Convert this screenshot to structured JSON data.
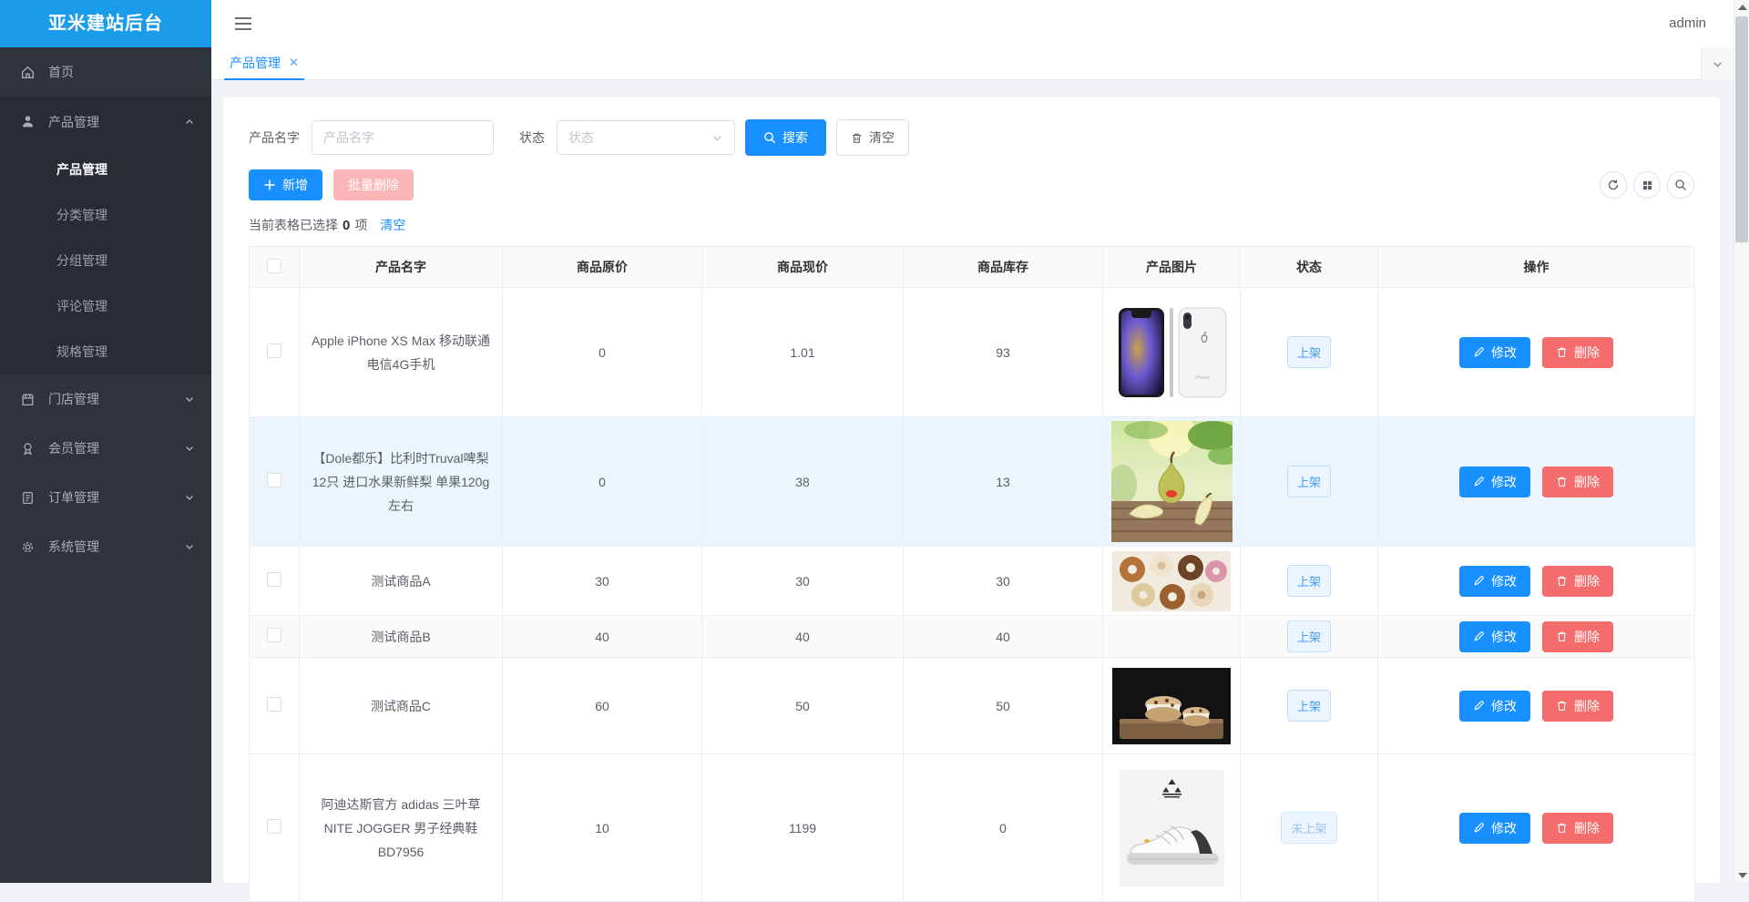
{
  "app": {
    "title": "亚米建站后台",
    "user": "admin"
  },
  "colors": {
    "primary": "#1890ff",
    "logo_bg": "#1a9ceb",
    "danger": "#f56c6c",
    "danger_disabled": "#fab6b6",
    "sidebar_bg": "#2f343b",
    "row_hover_bg": "#ecf5fd",
    "tag_bg": "#ecf5ff",
    "tag_text": "#3f9cf7"
  },
  "sidebar": {
    "items": [
      {
        "label": "首页",
        "icon": "home-icon"
      },
      {
        "label": "产品管理",
        "icon": "user-icon",
        "expanded": true,
        "children": [
          {
            "label": "产品管理",
            "active": true
          },
          {
            "label": "分类管理"
          },
          {
            "label": "分组管理"
          },
          {
            "label": "评论管理"
          },
          {
            "label": "规格管理"
          }
        ]
      },
      {
        "label": "门店管理",
        "icon": "shop-icon"
      },
      {
        "label": "会员管理",
        "icon": "member-icon"
      },
      {
        "label": "订单管理",
        "icon": "order-icon"
      },
      {
        "label": "系统管理",
        "icon": "system-icon"
      }
    ]
  },
  "tabbar": {
    "active_tab": "产品管理"
  },
  "filters": {
    "name_label": "产品名字",
    "name_placeholder": "产品名字",
    "status_label": "状态",
    "status_placeholder": "状态",
    "search_label": "搜索",
    "clear_label": "清空"
  },
  "toolbar": {
    "add_label": "新增",
    "batch_delete_label": "批量删除"
  },
  "selection": {
    "prefix": "当前表格已选择",
    "count": "0",
    "suffix": "项",
    "clear_label": "清空"
  },
  "table": {
    "headers": [
      "产品名字",
      "商品原价",
      "商品现价",
      "商品库存",
      "产品图片",
      "状态",
      "操作"
    ],
    "actions": {
      "edit_label": "修改",
      "delete_label": "删除"
    },
    "rows": [
      {
        "name": "Apple iPhone XS Max 移动联通电信4G手机",
        "original_price": "0",
        "current_price": "1.01",
        "stock": "93",
        "image": "iphone-pair",
        "status": "上架"
      },
      {
        "name": "【Dole都乐】比利时Truval啤梨12只 进口水果新鲜梨 单果120g左右",
        "original_price": "0",
        "current_price": "38",
        "stock": "13",
        "image": "pears",
        "status": "上架"
      },
      {
        "name": "测试商品A",
        "original_price": "30",
        "current_price": "30",
        "stock": "30",
        "image": "donuts",
        "status": "上架"
      },
      {
        "name": "测试商品B",
        "original_price": "40",
        "current_price": "40",
        "stock": "40",
        "image": null,
        "status": "上架"
      },
      {
        "name": "测试商品C",
        "original_price": "60",
        "current_price": "50",
        "stock": "50",
        "image": "cookies",
        "status": "上架"
      },
      {
        "name": "阿迪达斯官方 adidas 三叶草 NITE JOGGER 男子经典鞋BD7956",
        "original_price": "10",
        "current_price": "1199",
        "stock": "0",
        "image": "sneaker",
        "status": "未上架"
      }
    ]
  }
}
